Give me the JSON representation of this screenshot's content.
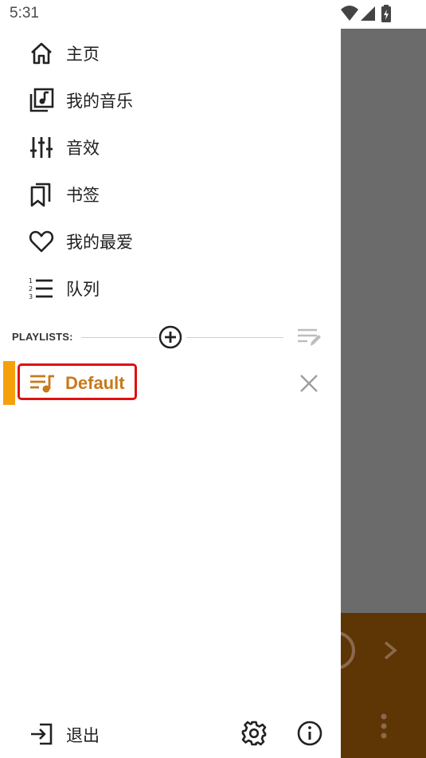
{
  "status_bar": {
    "time": "5:31"
  },
  "menu": {
    "items": [
      {
        "label": "主页",
        "icon": "home-icon"
      },
      {
        "label": "我的音乐",
        "icon": "library-music-icon"
      },
      {
        "label": "音效",
        "icon": "equalizer-icon"
      },
      {
        "label": "书签",
        "icon": "bookmarks-icon"
      },
      {
        "label": "我的最爱",
        "icon": "heart-icon"
      },
      {
        "label": "队列",
        "icon": "numbered-list-icon"
      }
    ]
  },
  "playlists": {
    "header_label": "PLAYLISTS:",
    "items": [
      {
        "name": "Default",
        "selected": true
      }
    ]
  },
  "footer": {
    "exit_label": "退出"
  },
  "colors": {
    "accent_orange": "#f4a10b",
    "playlist_text": "#c8791a",
    "highlight_border": "#e01010",
    "mini_player_bg": "#5e3505",
    "scrim": "#6b6b6b"
  }
}
